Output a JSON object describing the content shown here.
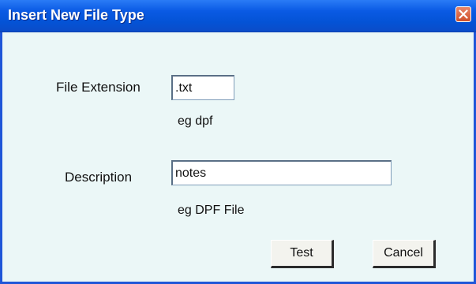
{
  "dialog": {
    "title": "Insert New File Type",
    "close_icon": "close-icon"
  },
  "form": {
    "extension_label": "File Extension",
    "extension_value": ".txt",
    "extension_hint": "eg dpf",
    "description_label": "Description",
    "description_value": "notes",
    "description_hint": "eg DPF File"
  },
  "buttons": {
    "test_label": "Test",
    "cancel_label": "Cancel"
  },
  "colors": {
    "titlebar": "#0453d6",
    "dialog_bg": "#ebf7f7",
    "close_button": "#cf4f2a"
  }
}
